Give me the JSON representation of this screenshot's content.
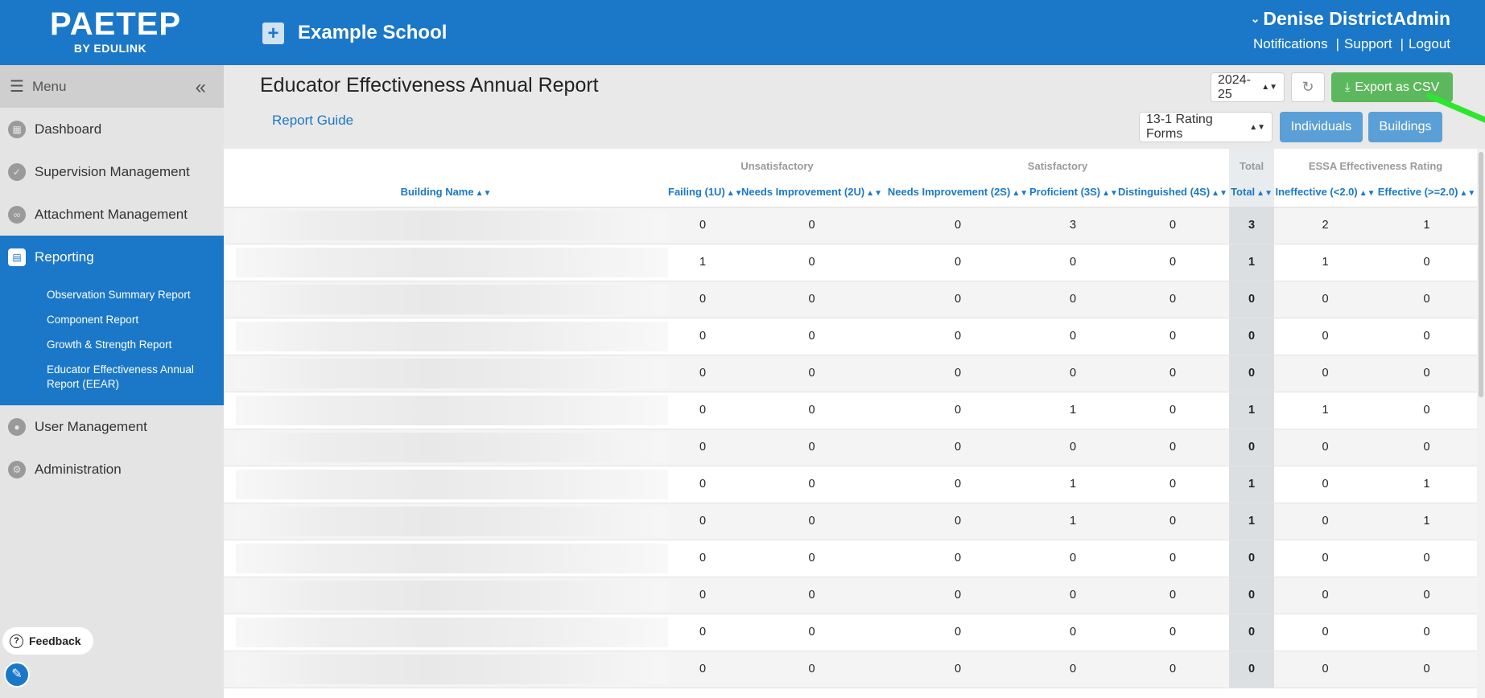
{
  "header": {
    "logo_main": "PAETEP",
    "logo_sub": "BY EDULINK",
    "school_name": "Example School",
    "user_name": "Denise DistrictAdmin",
    "links": [
      "Notifications",
      "Support",
      "Logout"
    ]
  },
  "sidebar": {
    "menu_label": "Menu",
    "items": [
      {
        "label": "Dashboard",
        "icon": "dashboard-icon"
      },
      {
        "label": "Supervision Management",
        "icon": "check-icon"
      },
      {
        "label": "Attachment Management",
        "icon": "paperclip-icon"
      },
      {
        "label": "Reporting",
        "icon": "report-icon"
      },
      {
        "label": "User Management",
        "icon": "user-icon"
      },
      {
        "label": "Administration",
        "icon": "gear-icon"
      }
    ],
    "sub_items": [
      "Observation Summary Report",
      "Component Report",
      "Growth & Strength Report",
      "Educator Effectiveness Annual Report (EEAR)"
    ],
    "feedback_label": "Feedback"
  },
  "main": {
    "title": "Educator Effectiveness Annual Report",
    "report_guide": "Report Guide",
    "year": "2024-25",
    "export_label": "Export as CSV",
    "rating_forms": "13-1 Rating Forms",
    "individuals_label": "Individuals",
    "buildings_label": "Buildings"
  },
  "table": {
    "groups": [
      "Unsatisfactory",
      "Satisfactory",
      "Total",
      "ESSA Effectiveness Rating"
    ],
    "columns": [
      "Building Name",
      "Failing (1U)",
      "Needs Improvement (2U)",
      "Needs Improvement (2S)",
      "Proficient (3S)",
      "Distinguished (4S)",
      "Total",
      "Ineffective (<2.0)",
      "Effective (>=2.0)"
    ],
    "rows": [
      [
        "0",
        "0",
        "0",
        "3",
        "0",
        "3",
        "2",
        "1"
      ],
      [
        "1",
        "0",
        "0",
        "0",
        "0",
        "1",
        "1",
        "0"
      ],
      [
        "0",
        "0",
        "0",
        "0",
        "0",
        "0",
        "0",
        "0"
      ],
      [
        "0",
        "0",
        "0",
        "0",
        "0",
        "0",
        "0",
        "0"
      ],
      [
        "0",
        "0",
        "0",
        "0",
        "0",
        "0",
        "0",
        "0"
      ],
      [
        "0",
        "0",
        "0",
        "1",
        "0",
        "1",
        "1",
        "0"
      ],
      [
        "0",
        "0",
        "0",
        "0",
        "0",
        "0",
        "0",
        "0"
      ],
      [
        "0",
        "0",
        "0",
        "1",
        "0",
        "1",
        "0",
        "1"
      ],
      [
        "0",
        "0",
        "0",
        "1",
        "0",
        "1",
        "0",
        "1"
      ],
      [
        "0",
        "0",
        "0",
        "0",
        "0",
        "0",
        "0",
        "0"
      ],
      [
        "0",
        "0",
        "0",
        "0",
        "0",
        "0",
        "0",
        "0"
      ],
      [
        "0",
        "0",
        "0",
        "0",
        "0",
        "0",
        "0",
        "0"
      ],
      [
        "0",
        "0",
        "0",
        "0",
        "0",
        "0",
        "0",
        "0"
      ]
    ]
  },
  "colors": {
    "brand_blue": "#1b78c8",
    "export_green": "#5cb85c",
    "button_blue": "#5a9fd6"
  }
}
